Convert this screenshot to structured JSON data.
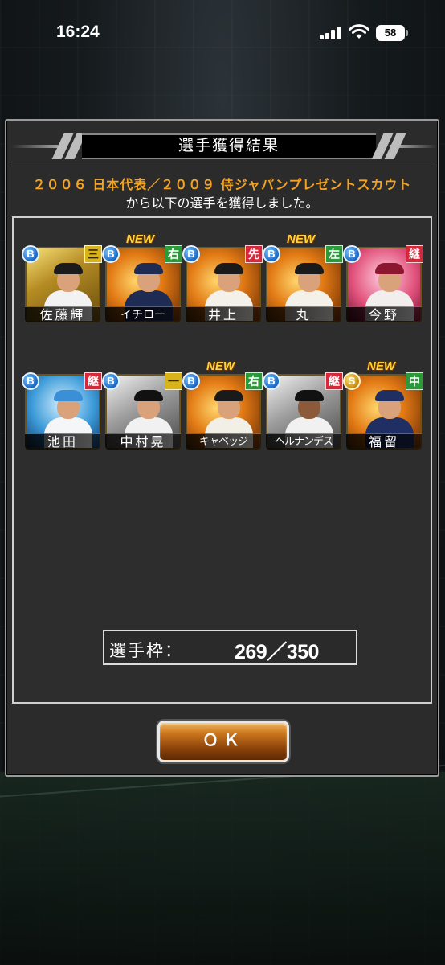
{
  "status_bar": {
    "time": "16:24",
    "battery": "58"
  },
  "dialog": {
    "title": "選手獲得結果",
    "scout_name": "２００６ 日本代表／２００９ 侍ジャパンプレゼントスカウト",
    "message": "から以下の選手を獲得しました。",
    "slot_label": "選手枠：",
    "slot_value": "269／350",
    "ok_label": "ＯＫ"
  },
  "players": [
    {
      "name": "佐藤輝",
      "rank": "B",
      "position": "三",
      "new": false
    },
    {
      "name": "イチロー",
      "rank": "B",
      "position": "右",
      "new": true,
      "new_label": "NEW"
    },
    {
      "name": "井上",
      "rank": "B",
      "position": "先",
      "new": false
    },
    {
      "name": "丸",
      "rank": "B",
      "position": "左",
      "new": true,
      "new_label": "NEW"
    },
    {
      "name": "今野",
      "rank": "B",
      "position": "継",
      "new": false
    },
    {
      "name": "池田",
      "rank": "B",
      "position": "継",
      "new": false
    },
    {
      "name": "中村晃",
      "rank": "B",
      "position": "一",
      "new": false
    },
    {
      "name": "キャベッジ",
      "rank": "B",
      "position": "右",
      "new": true,
      "new_label": "NEW"
    },
    {
      "name": "ヘルナンデス",
      "rank": "B",
      "position": "継",
      "new": false
    },
    {
      "name": "福留",
      "rank": "S",
      "position": "中",
      "new": true,
      "new_label": "NEW"
    }
  ],
  "icons": {
    "signal": "cellular-signal-icon",
    "wifi": "wifi-icon",
    "battery": "battery-icon"
  }
}
